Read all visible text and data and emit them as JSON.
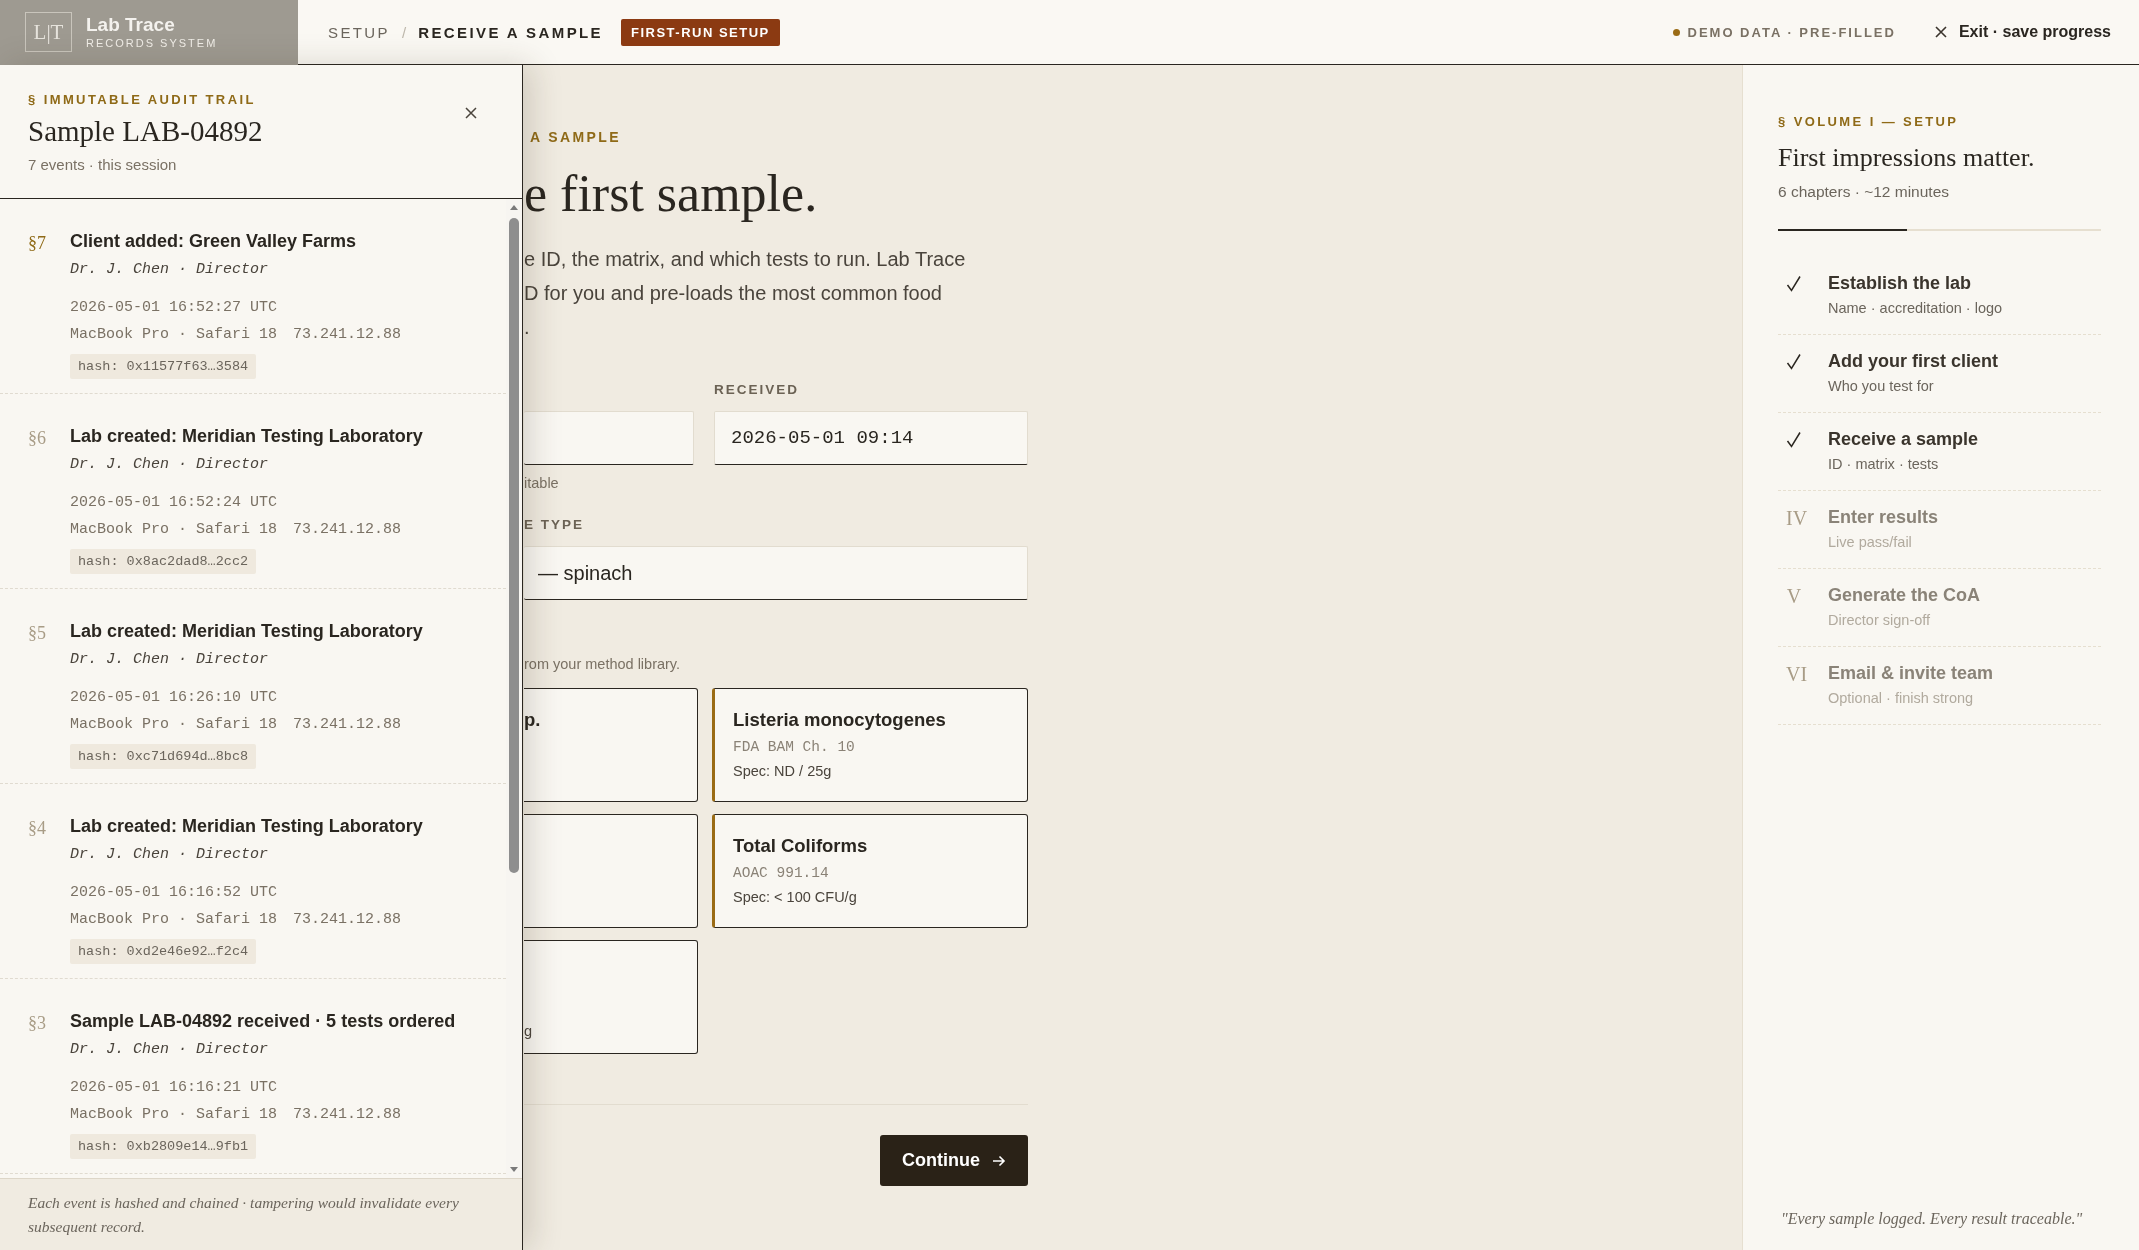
{
  "topbar": {
    "logo": {
      "mark": "L|T",
      "name": "Lab Trace",
      "tagline": "RECORDS SYSTEM"
    },
    "breadcrumb": [
      "SETUP",
      "RECEIVE A SAMPLE"
    ],
    "separator": "/",
    "badge": "FIRST-RUN SETUP",
    "demo_status": "DEMO DATA · PRE-FILLED",
    "exit": "Exit · save progress"
  },
  "drawer": {
    "eyebrow": "§ IMMUTABLE AUDIT TRAIL",
    "title": "Sample LAB-04892",
    "subtitle": "7 events · this session",
    "events": [
      {
        "number": "§7",
        "latest": true,
        "title": "Client added: Green Valley Farms",
        "actor": "Dr. J. Chen · Director",
        "time": "2026-05-01 16:52:27 UTC",
        "device": "MacBook Pro · Safari 18",
        "ip": "73.241.12.88",
        "hash": "hash: 0x11577f63…3584"
      },
      {
        "number": "§6",
        "latest": false,
        "title": "Lab created: Meridian Testing Laboratory",
        "actor": "Dr. J. Chen · Director",
        "time": "2026-05-01 16:52:24 UTC",
        "device": "MacBook Pro · Safari 18",
        "ip": "73.241.12.88",
        "hash": "hash: 0x8ac2dad8…2cc2"
      },
      {
        "number": "§5",
        "latest": false,
        "title": "Lab created: Meridian Testing Laboratory",
        "actor": "Dr. J. Chen · Director",
        "time": "2026-05-01 16:26:10 UTC",
        "device": "MacBook Pro · Safari 18",
        "ip": "73.241.12.88",
        "hash": "hash: 0xc71d694d…8bc8"
      },
      {
        "number": "§4",
        "latest": false,
        "title": "Lab created: Meridian Testing Laboratory",
        "actor": "Dr. J. Chen · Director",
        "time": "2026-05-01 16:16:52 UTC",
        "device": "MacBook Pro · Safari 18",
        "ip": "73.241.12.88",
        "hash": "hash: 0xd2e46e92…f2c4"
      },
      {
        "number": "§3",
        "latest": false,
        "title": "Sample LAB-04892 received · 5 tests ordered",
        "actor": "Dr. J. Chen · Director",
        "time": "2026-05-01 16:16:21 UTC",
        "device": "MacBook Pro · Safari 18",
        "ip": "73.241.12.88",
        "hash": "hash: 0xb2809e14…9fb1"
      }
    ],
    "footer": "Each event is hashed and chained · tampering would invalidate every subsequent record."
  },
  "main": {
    "eyebrow": "A SAMPLE",
    "heading": "e first sample.",
    "intro_lines": [
      "e ID, the matrix, and which tests to run. Lab Trace",
      "D for you and pre-loads the most common food",
      "."
    ],
    "id_field": {
      "hint": "itable"
    },
    "received": {
      "label": "RECEIVED",
      "value": "2026-05-01 09:14"
    },
    "type_field": {
      "label": "E TYPE",
      "value": "— spinach"
    },
    "tests_hint": "rom your method library.",
    "tests": [
      {
        "name": "p.",
        "selected": false
      },
      {
        "name": "Listeria monocytogenes",
        "method": "FDA BAM Ch. 10",
        "spec": "Spec: ND / 25g",
        "selected": true
      },
      {
        "selected": false
      },
      {
        "name": "Total Coliforms",
        "method": "AOAC 991.14",
        "spec": "Spec: < 100 CFU/g",
        "selected": true
      },
      {
        "spec": "g",
        "selected": false
      }
    ],
    "continue": "Continue"
  },
  "sidebar": {
    "eyebrow": "§ VOLUME I — SETUP",
    "title": "First impressions matter.",
    "meta": "6 chapters · ~12 minutes",
    "progress": {
      "level": 0.4
    },
    "chapters": [
      {
        "done": true,
        "title": "Establish the lab",
        "detail": "Name · accreditation · logo"
      },
      {
        "done": true,
        "title": "Add your first client",
        "detail": "Who you test for"
      },
      {
        "done": true,
        "title": "Receive a sample",
        "detail": "ID · matrix · tests"
      },
      {
        "done": false,
        "numeral": "IV",
        "title": "Enter results",
        "detail": "Live pass/fail"
      },
      {
        "done": false,
        "numeral": "V",
        "title": "Generate the CoA",
        "detail": "Director sign-off"
      },
      {
        "done": false,
        "numeral": "VI",
        "title": "Email & invite team",
        "detail": "Optional · finish strong"
      }
    ],
    "quote": "\"Every sample logged. Every result traceable.\""
  }
}
